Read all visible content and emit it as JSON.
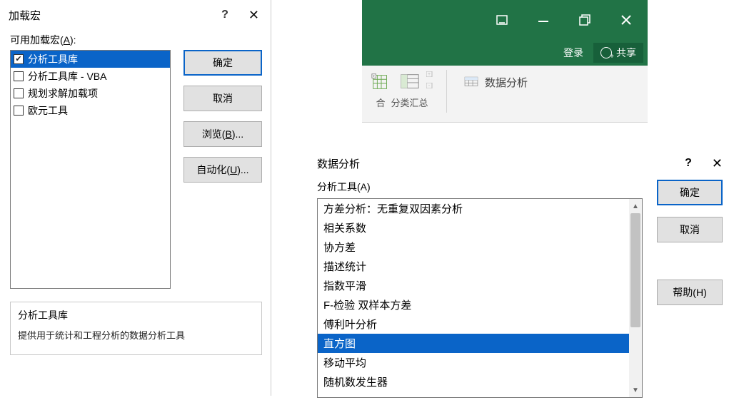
{
  "addins_dialog": {
    "title": "加载宏",
    "available_label_pre": "可用加载宏(",
    "available_label_hot": "A",
    "available_label_post": "):",
    "items": [
      {
        "label": "分析工具库",
        "checked": true,
        "selected": true
      },
      {
        "label": "分析工具库 - VBA",
        "checked": false,
        "selected": false
      },
      {
        "label": "规划求解加载项",
        "checked": false,
        "selected": false
      },
      {
        "label": "欧元工具",
        "checked": false,
        "selected": false
      }
    ],
    "buttons": {
      "ok": "确定",
      "cancel": "取消",
      "browse_pre": "浏览(",
      "browse_hot": "B",
      "browse_post": ")...",
      "auto_pre": "自动化(",
      "auto_hot": "U",
      "auto_post": ")..."
    },
    "desc_title": "分析工具库",
    "desc_body": "提供用于统计和工程分析的数据分析工具"
  },
  "ribbon": {
    "login": "登录",
    "share": "共享",
    "group_lbl_left": "合",
    "group_lbl_right": "分类汇总",
    "data_analysis": "数据分析"
  },
  "da_dialog": {
    "title": "数据分析",
    "tools_label_pre": "分析工具(",
    "tools_label_hot": "A",
    "tools_label_post": ")",
    "tools": [
      {
        "label": "方差分析：无重复双因素分析",
        "selected": false
      },
      {
        "label": "相关系数",
        "selected": false
      },
      {
        "label": "协方差",
        "selected": false
      },
      {
        "label": "描述统计",
        "selected": false
      },
      {
        "label": "指数平滑",
        "selected": false
      },
      {
        "label": "F-检验 双样本方差",
        "selected": false
      },
      {
        "label": "傅利叶分析",
        "selected": false
      },
      {
        "label": "直方图",
        "selected": true
      },
      {
        "label": "移动平均",
        "selected": false
      },
      {
        "label": "随机数发生器",
        "selected": false
      }
    ],
    "buttons": {
      "ok": "确定",
      "cancel": "取消",
      "help_pre": "帮助(",
      "help_hot": "H",
      "help_post": ")"
    }
  }
}
